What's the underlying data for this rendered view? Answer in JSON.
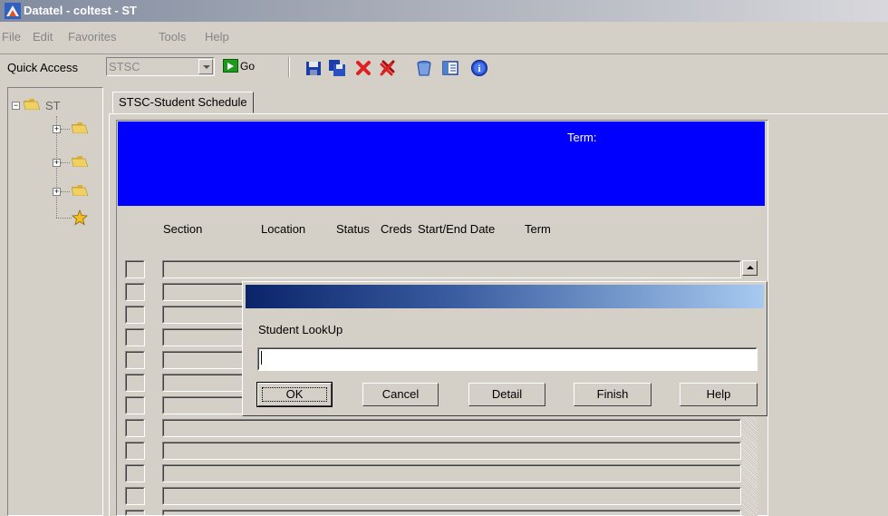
{
  "window": {
    "title": "Datatel - coltest - ST"
  },
  "menu": [
    "File",
    "Edit",
    "Favorites",
    "Tools",
    "Help"
  ],
  "toolbar": {
    "quick_access_label": "Quick Access",
    "quick_access_value": "STSC",
    "go_label": "Go",
    "icons": [
      "save-icon",
      "save-all-icon",
      "delete-icon",
      "delete-all-icon",
      "cancel-bucket-icon",
      "form-details-icon",
      "help-icon"
    ]
  },
  "tree": {
    "root_label": "ST"
  },
  "tab": {
    "label": "STSC-Student Schedule"
  },
  "form": {
    "term_label": "Term:",
    "columns": [
      "Section",
      "Location",
      "Status",
      "Creds",
      "Start/End Date",
      "Term"
    ]
  },
  "dialog": {
    "label": "Student LookUp",
    "input_value": "",
    "buttons": [
      "OK",
      "Cancel",
      "Detail",
      "Finish",
      "Help"
    ]
  },
  "colors": {
    "header_blue": "#0000ff",
    "dialog_title_start": "#0a246a",
    "dialog_title_end": "#a6caf0"
  }
}
